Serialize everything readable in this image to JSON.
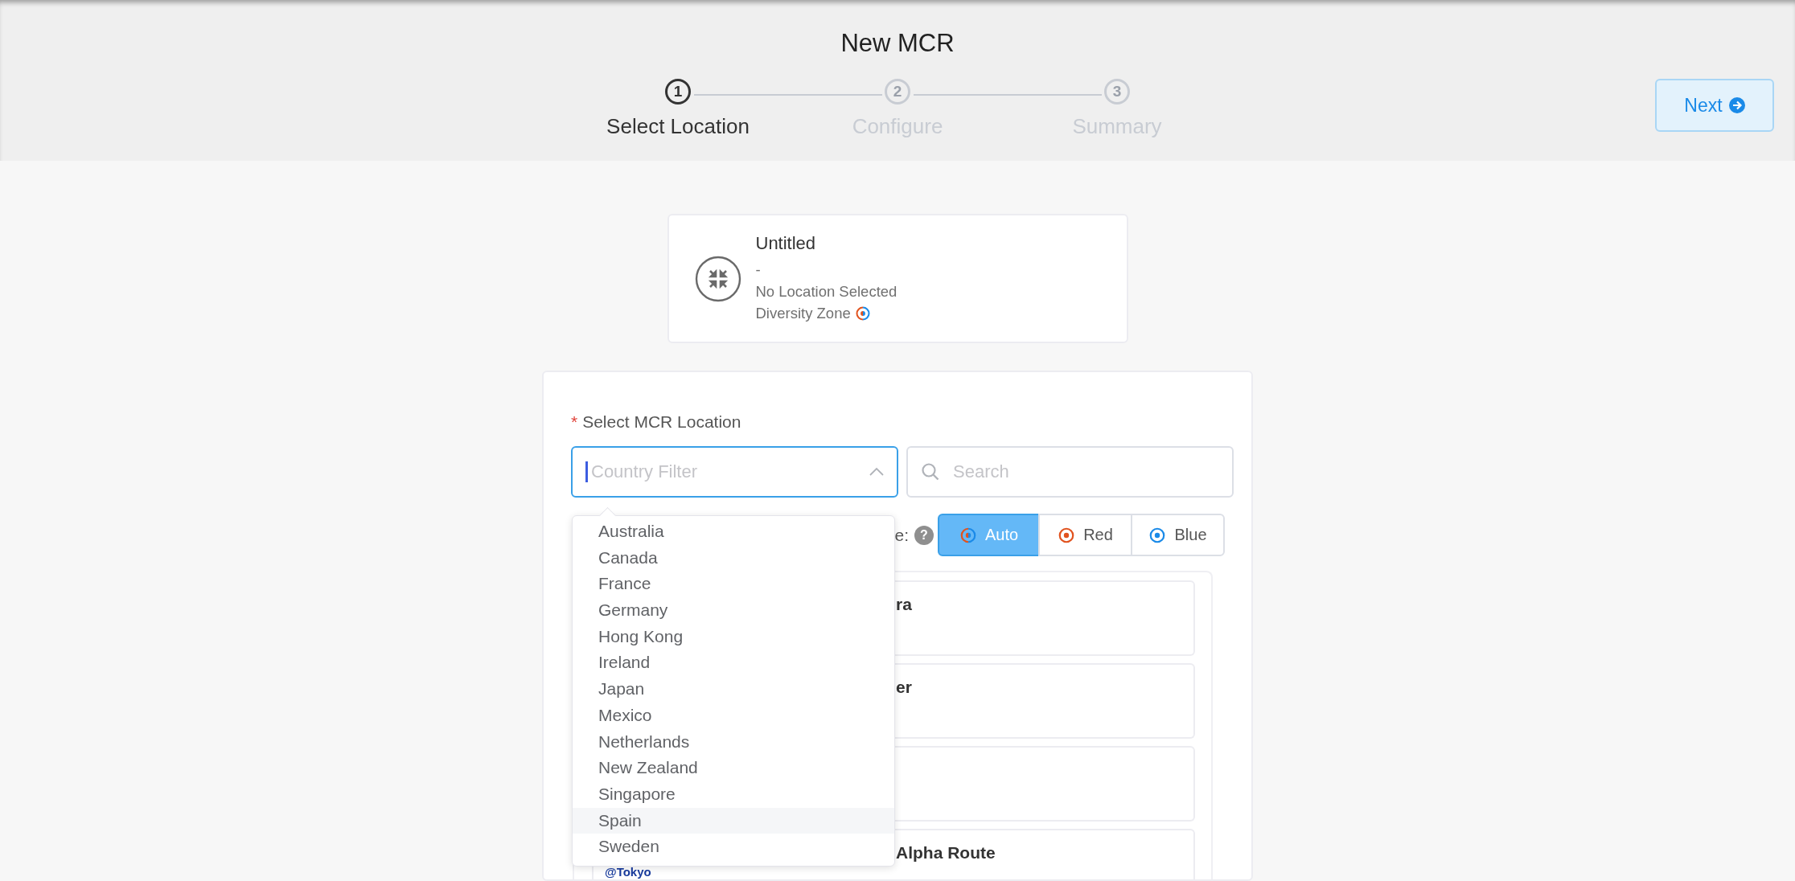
{
  "header": {
    "title": "New MCR",
    "next_button": {
      "label": "Next"
    }
  },
  "steps": [
    {
      "number": "1",
      "label": "Select Location",
      "selected": true
    },
    {
      "number": "2",
      "label": "Configure",
      "selected": false
    },
    {
      "number": "3",
      "label": "Summary",
      "selected": false
    }
  ],
  "summary_card": {
    "title": "Untitled",
    "subtitle": "-",
    "location": "No Location Selected",
    "diversity_label": "Diversity Zone"
  },
  "form": {
    "label": "Select MCR Location",
    "required_mark": "*",
    "country_filter": {
      "placeholder": "Country Filter",
      "expanded": true
    },
    "search": {
      "placeholder": "Search"
    },
    "diversity_label": "e:",
    "help_icon": "?",
    "diversity_options": [
      {
        "label": "Auto",
        "kind": "auto",
        "selected": true
      },
      {
        "label": "Red",
        "kind": "red",
        "selected": false
      },
      {
        "label": "Blue",
        "kind": "blue",
        "selected": false
      }
    ]
  },
  "country_options": [
    {
      "label": "Australia",
      "selected": false
    },
    {
      "label": "Canada",
      "selected": false
    },
    {
      "label": "France",
      "selected": false
    },
    {
      "label": "Germany",
      "selected": false
    },
    {
      "label": "Hong Kong",
      "selected": false
    },
    {
      "label": "Ireland",
      "selected": false
    },
    {
      "label": "Japan",
      "selected": false
    },
    {
      "label": "Mexico",
      "selected": false
    },
    {
      "label": "Netherlands",
      "selected": false
    },
    {
      "label": "New Zealand",
      "selected": false
    },
    {
      "label": "Singapore",
      "selected": false
    },
    {
      "label": "Spain",
      "selected": true
    },
    {
      "label": "Sweden",
      "selected": false
    }
  ],
  "locations": [
    {
      "kind": "location",
      "title": "ra"
    },
    {
      "kind": "location",
      "title": "er"
    },
    {
      "kind": "location"
    },
    {
      "kind": "location",
      "title": "Alpha Route",
      "logo": "@Tokyo"
    }
  ]
}
